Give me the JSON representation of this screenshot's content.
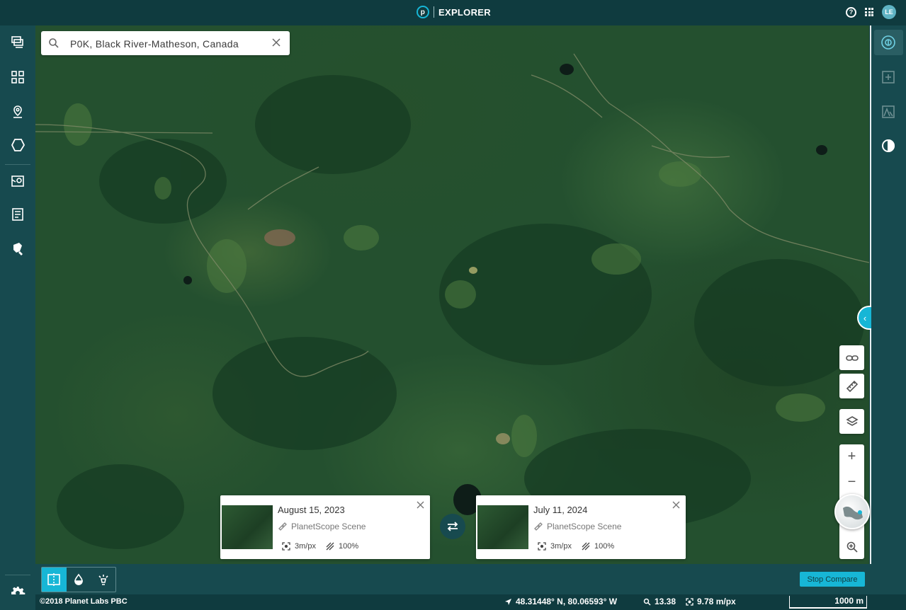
{
  "header": {
    "logo_letter": "p",
    "app_title": "EXPLORER",
    "help_label": "?",
    "avatar_initials": "LE"
  },
  "left_nav": {
    "items": [
      "scenes-icon",
      "mosaics-icon",
      "places-icon",
      "areas-icon",
      "tasking-icon",
      "orders-icon",
      "analysis-icon"
    ],
    "settings_icon": "gear-icon"
  },
  "right_nav": {
    "items": [
      "compare-icon",
      "add-scene-icon",
      "terrain-icon",
      "timelapse-icon"
    ]
  },
  "search": {
    "value": "P0K, Black River-Matheson, Canada"
  },
  "compare": {
    "left": {
      "date": "August 15, 2023",
      "type": "PlanetScope Scene",
      "resolution": "3m/px",
      "coverage": "100%"
    },
    "right": {
      "date": "July 11, 2024",
      "type": "PlanetScope Scene",
      "resolution": "3m/px",
      "coverage": "100%"
    },
    "stop_label": "Stop Compare"
  },
  "map_tools": {
    "zoom_in": "+",
    "zoom_out": "−",
    "collapse": "‹"
  },
  "status": {
    "copyright": "©2018 Planet Labs PBC",
    "coordinates": "48.31448° N, 80.06593° W",
    "zoom": "13.38",
    "resolution": "9.78 m/px",
    "scale": "1000 m"
  },
  "colors": {
    "header_bg": "#0f3b3f",
    "sidebar_bg": "#174a4f",
    "accent": "#17b6d6"
  }
}
